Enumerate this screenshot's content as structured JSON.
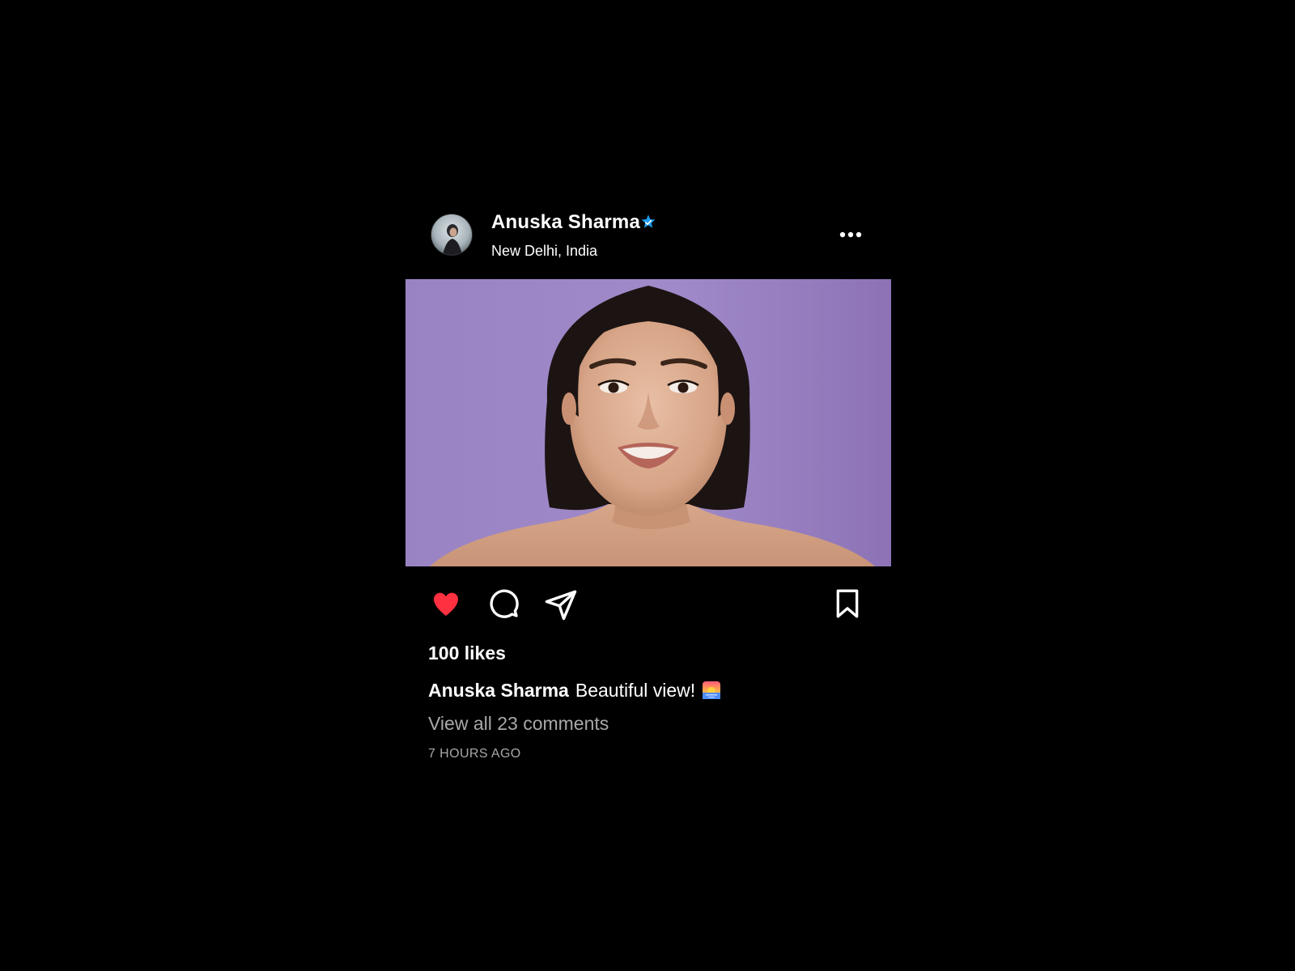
{
  "post": {
    "user": {
      "name": "Anuska Sharma",
      "location": "New Delhi, India",
      "verified": true,
      "verified_color": "#1d9bf0"
    },
    "header_icons": {
      "more": "more-options-icon"
    },
    "photo": {
      "background_color": "#9b84c4"
    },
    "actions": {
      "like": {
        "icon": "heart-icon",
        "liked": true,
        "color": "#ff3040"
      },
      "comment": {
        "icon": "comment-icon"
      },
      "share": {
        "icon": "send-icon"
      },
      "save": {
        "icon": "bookmark-icon"
      }
    },
    "likes_text": "100 likes",
    "caption": {
      "user": "Anuska Sharma",
      "text": "Beautiful view!",
      "emoji": "sunrise-emoji"
    },
    "comments_link": "View all 23 comments",
    "timestamp": "7 HOURS AGO"
  }
}
